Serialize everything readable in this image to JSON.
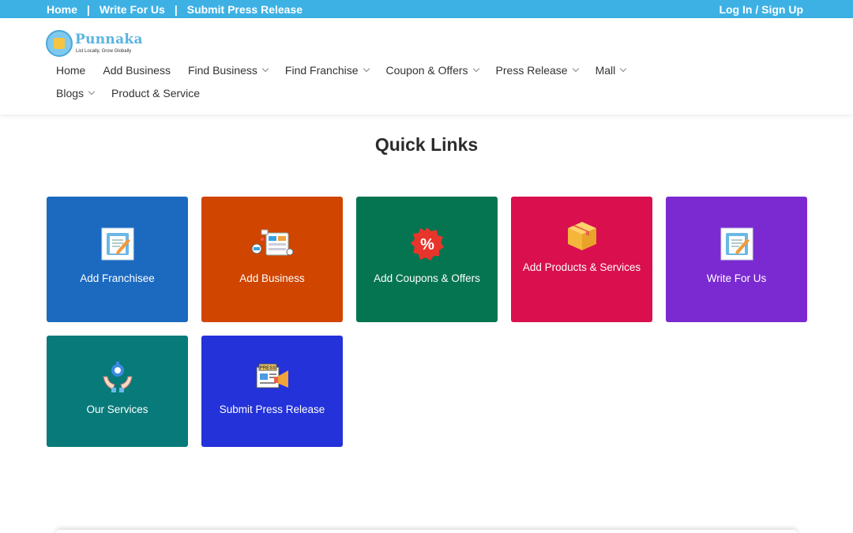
{
  "topbar": {
    "home": "Home",
    "sep": "|",
    "write_for_us": "Write For Us",
    "submit_press_release": "Submit Press Release",
    "login": "Log In / Sign Up"
  },
  "logo": {
    "name": "Punnaka",
    "tagline": "List Locally, Grow Globally"
  },
  "nav": {
    "row1": [
      {
        "label": "Home",
        "dropdown": false
      },
      {
        "label": "Add Business",
        "dropdown": false
      },
      {
        "label": "Find Business",
        "dropdown": true
      },
      {
        "label": "Find Franchise",
        "dropdown": true
      },
      {
        "label": "Coupon & Offers",
        "dropdown": true
      },
      {
        "label": "Press Release",
        "dropdown": true
      },
      {
        "label": "Mall",
        "dropdown": true
      }
    ],
    "row2": [
      {
        "label": "Blogs",
        "dropdown": true
      },
      {
        "label": "Product & Service",
        "dropdown": false
      }
    ]
  },
  "quick_links": {
    "title": "Quick Links",
    "cards": [
      {
        "label": "Add Franchisee",
        "color": "#1b6ac0",
        "icon": "franchise-icon"
      },
      {
        "label": "Add Business",
        "color": "#d04500",
        "icon": "business-icon"
      },
      {
        "label": "Add Coupons & Offers",
        "color": "#047550",
        "icon": "coupon-icon"
      },
      {
        "label": "Add Products & Services",
        "color": "#d90f4e",
        "icon": "product-box-icon"
      },
      {
        "label": "Write For Us",
        "color": "#7b2ad1",
        "icon": "write-icon"
      },
      {
        "label": "Our Services",
        "color": "#087a7a",
        "icon": "services-icon"
      },
      {
        "label": "Submit Press Release",
        "color": "#2332d9",
        "icon": "press-release-icon"
      }
    ]
  },
  "colors": {
    "topbar": "#3db1e4",
    "brand": "#5ab3e0"
  }
}
